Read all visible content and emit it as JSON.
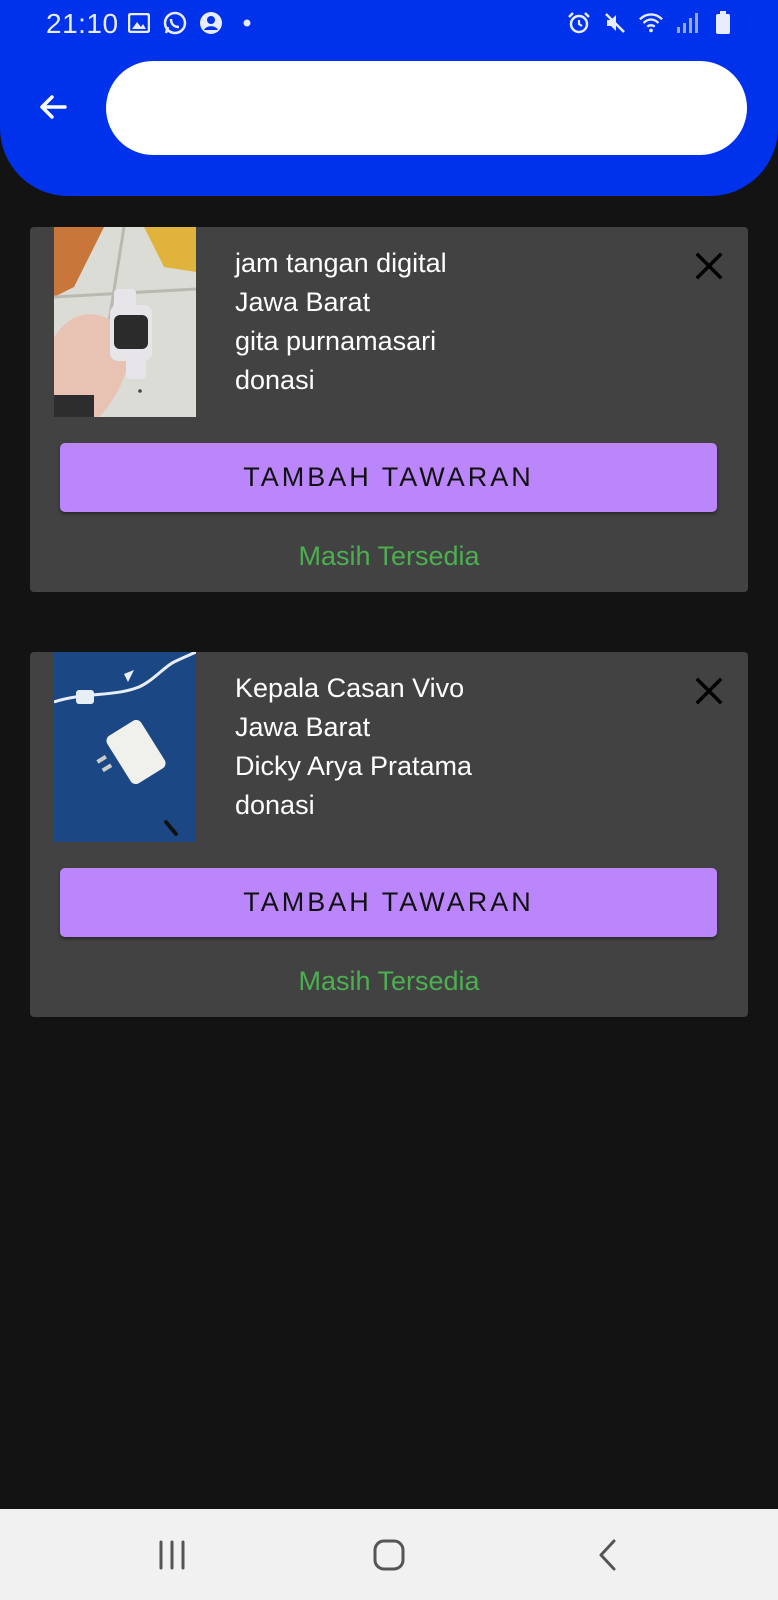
{
  "status_bar": {
    "time": "21:10",
    "left_icons": [
      "gallery-icon",
      "whatsapp-icon",
      "account-icon",
      "dot-icon"
    ],
    "right_icons": [
      "alarm-icon",
      "mute-icon",
      "wifi-icon",
      "signal-icon",
      "battery-icon"
    ]
  },
  "header": {
    "back_icon": "arrow-left-icon",
    "search_value": "",
    "search_placeholder": ""
  },
  "items": [
    {
      "name": "jam tangan digital",
      "region": "Jawa Barat",
      "owner": "gita purnamasari",
      "type": "donasi",
      "offer_label": "TAMBAH TAWARAN",
      "status": "Masih Tersedia",
      "image": "photo of a hand holding a white smartwatch"
    },
    {
      "name": "Kepala Casan Vivo",
      "region": "Jawa Barat",
      "owner": "Dicky Arya Pratama",
      "type": "donasi",
      "offer_label": "TAMBAH TAWARAN",
      "status": "Masih Tersedia",
      "image": "photo of a white phone charger on a blue surface"
    }
  ],
  "colors": {
    "header": "#0032EB",
    "background": "#131313",
    "card": "#424242",
    "button": "#BB86FC",
    "status_text": "#4CAF50"
  },
  "nav_bar": {
    "icons": [
      "recent-apps-icon",
      "home-icon",
      "back-icon"
    ]
  }
}
